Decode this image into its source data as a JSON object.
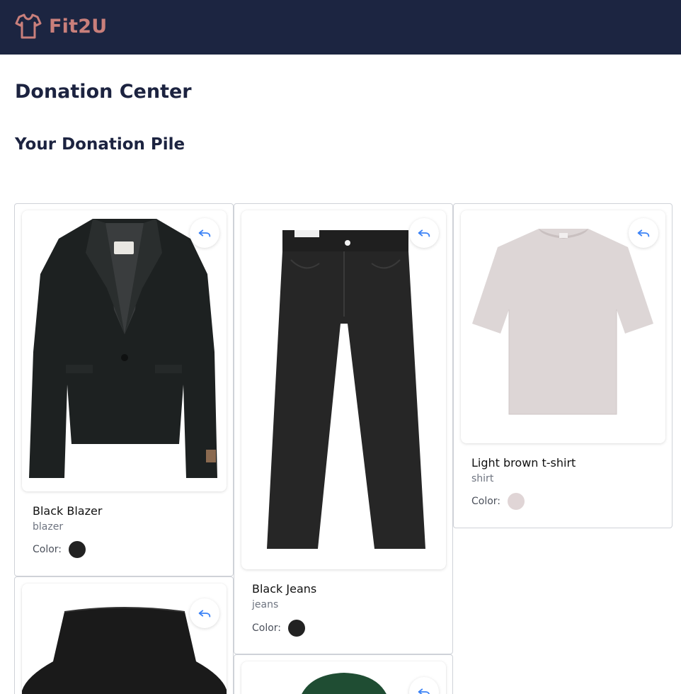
{
  "app": {
    "brand": "Fit2U"
  },
  "page": {
    "title": "Donation Center",
    "section_title": "Your Donation Pile"
  },
  "labels": {
    "color": "Color:"
  },
  "items": [
    {
      "name": "Black Blazer",
      "type": "blazer",
      "color": "#222222"
    },
    {
      "name": "Black Jeans",
      "type": "jeans",
      "color": "#222222"
    },
    {
      "name": "Light brown t-shirt",
      "type": "shirt",
      "color": "#e0d5d6"
    }
  ],
  "theme": {
    "navbar": "#1c2541",
    "brand": "#c97f7b",
    "undo_icon": "#3b82f6"
  }
}
